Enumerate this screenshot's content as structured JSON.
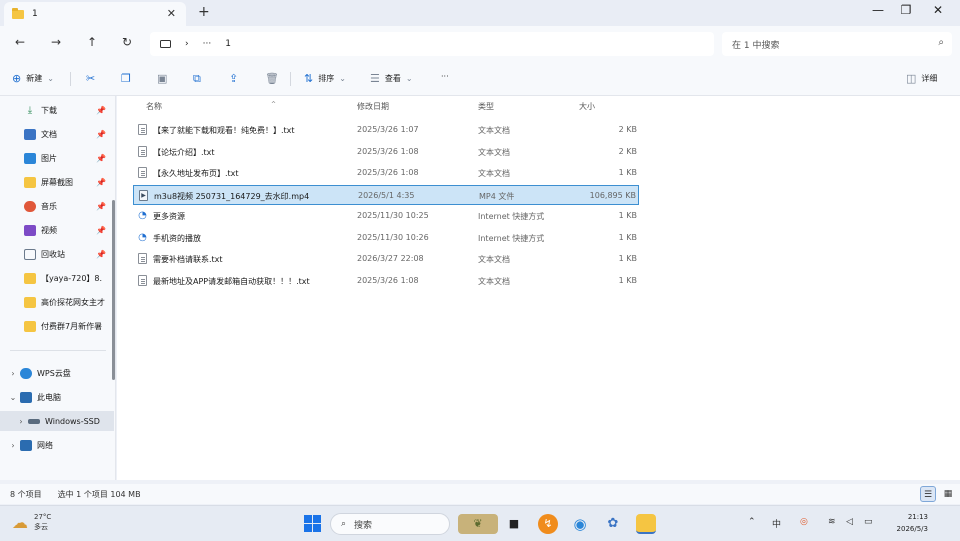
{
  "window": {
    "tab_title": "1",
    "tab_close": "✕",
    "tab_add": "+",
    "minimize": "—",
    "maximize": "❐",
    "close": "✕"
  },
  "address": {
    "back": "←",
    "forward": "→",
    "up": "↑",
    "refresh": "↻",
    "more": "···",
    "chevron": "›",
    "path": "1",
    "search_placeholder": "在 1 中搜索"
  },
  "commands": {
    "new_label": "新建",
    "sort_label": "排序",
    "view_label": "查看",
    "more": "···",
    "details_label": "详细"
  },
  "sidebar": {
    "quick": [
      {
        "label": "下载",
        "icon": "download-icon",
        "color": "#2e8b57"
      },
      {
        "label": "文档",
        "icon": "document-icon",
        "color": "#3b74c4"
      },
      {
        "label": "图片",
        "icon": "pictures-icon",
        "color": "#2b86d8"
      },
      {
        "label": "屏幕截图",
        "icon": "folder-icon",
        "color": "#f5c542"
      },
      {
        "label": "音乐",
        "icon": "music-icon",
        "color": "#e0583a"
      },
      {
        "label": "视频",
        "icon": "video-icon",
        "color": "#7d4bc6"
      },
      {
        "label": "回收站",
        "icon": "recycle-bin-icon",
        "color": "#6b7a8c"
      },
      {
        "label": "【yaya-720】8.",
        "icon": "folder-icon",
        "color": "#f5c542"
      },
      {
        "label": "高价探花网女主才",
        "icon": "folder-icon",
        "color": "#f5c542"
      },
      {
        "label": "付费群7月新作暑",
        "icon": "folder-icon",
        "color": "#f5c542"
      }
    ],
    "drives": [
      {
        "label": "WPS云盘",
        "icon": "cloud-icon",
        "color": "#2b86d8"
      },
      {
        "label": "此电脑",
        "icon": "computer-icon",
        "color": "#2b6cb0"
      },
      {
        "label": "Windows-SSD",
        "icon": "drive-icon",
        "color": "#5a6b7e"
      },
      {
        "label": "网络",
        "icon": "network-icon",
        "color": "#2b6cb0"
      }
    ]
  },
  "table": {
    "headers": [
      "名称",
      "修改日期",
      "类型",
      "大小"
    ],
    "rows": [
      {
        "name": "【来了就能下载和观看！纯免费！】.txt",
        "date": "2025/3/26 1:07",
        "type": "文本文档",
        "size": "2 KB",
        "kind": "txt"
      },
      {
        "name": "【论坛介绍】.txt",
        "date": "2025/3/26 1:08",
        "type": "文本文档",
        "size": "2 KB",
        "kind": "txt"
      },
      {
        "name": "【永久地址发布页】.txt",
        "date": "2025/3/26 1:08",
        "type": "文本文档",
        "size": "1 KB",
        "kind": "txt"
      },
      {
        "name": "m3u8视频 250731_164729_去水印.mp4",
        "date": "2026/5/1 4:35",
        "type": "MP4 文件",
        "size": "106,895 KB",
        "kind": "mp4",
        "selected": true
      },
      {
        "name": "更多资源",
        "date": "2025/11/30 10:25",
        "type": "Internet 快捷方式",
        "size": "1 KB",
        "kind": "url"
      },
      {
        "name": "手机资的播放",
        "date": "2025/11/30 10:26",
        "type": "Internet 快捷方式",
        "size": "1 KB",
        "kind": "url"
      },
      {
        "name": "需要补档请联系.txt",
        "date": "2026/3/27 22:08",
        "type": "文本文档",
        "size": "1 KB",
        "kind": "txt"
      },
      {
        "name": "最新地址及APP请发邮箱自动获取！！！.txt",
        "date": "2025/3/26 1:08",
        "type": "文本文档",
        "size": "1 KB",
        "kind": "txt"
      }
    ]
  },
  "status": {
    "count": "8 个项目",
    "selection": "选中 1 个项目  104 MB"
  },
  "taskbar": {
    "temperature": "27°C",
    "weather": "多云",
    "search_label": "搜索",
    "time": "21:13",
    "date": "2026/5/3"
  }
}
